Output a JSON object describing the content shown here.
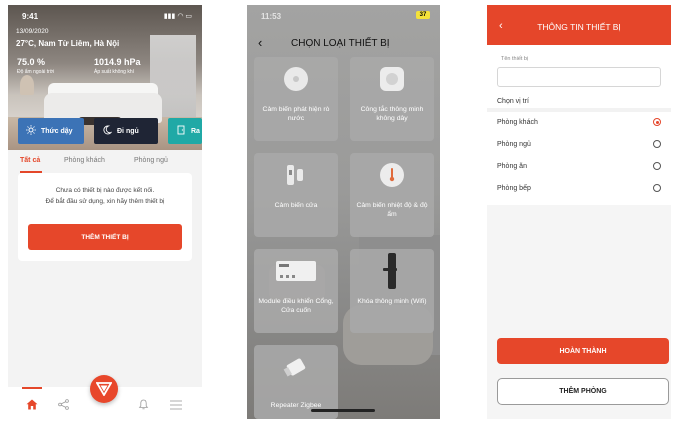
{
  "screen1": {
    "status_time": "9:41",
    "status_icons": "▮▮▮ ◠ ▭",
    "date": "13/09/2020",
    "weather": "27°C, Nam Từ Liêm, Hà Nội",
    "humidity_value": "75.0 %",
    "humidity_label": "Độ ẩm ngoài trời",
    "pressure_value": "1014.9 hPa",
    "pressure_label": "Áp suất không khí",
    "scenes": [
      {
        "label": "Thức dậy",
        "icon": "sun-icon"
      },
      {
        "label": "Đi ngủ",
        "icon": "moon-icon"
      },
      {
        "label": "Ra",
        "icon": "door-icon"
      }
    ],
    "tabs": [
      "Tất cả",
      "Phòng khách",
      "Phòng ngủ"
    ],
    "empty_message_line1": "Chưa có thiết bị nào được kết nối.",
    "empty_message_line2": "Để bắt đầu sử dụng, xin hãy thêm thiết bị",
    "add_device_button": "THÊM THIẾT BỊ",
    "nav_icons": [
      "home-icon",
      "share-icon",
      "logo-icon",
      "bell-icon",
      "menu-icon"
    ],
    "accent_color": "#e6472a"
  },
  "screen2": {
    "status_time": "11:53",
    "battery": "37",
    "title": "CHỌN LOẠI THIẾT BỊ",
    "device_types": [
      {
        "label": "Cảm biến phát hiện rò nước",
        "icon": "water-sensor-icon"
      },
      {
        "label": "Công tắc thông minh không dây",
        "icon": "wireless-switch-icon"
      },
      {
        "label": "Cảm biến cửa",
        "icon": "door-sensor-icon"
      },
      {
        "label": "Cảm biến nhiệt độ & độ ẩm",
        "icon": "thermometer-icon"
      },
      {
        "label": "Module điều khiển Cổng, Cửa cuốn",
        "icon": "gate-module-icon"
      },
      {
        "label": "Khóa thông minh (Wifi)",
        "icon": "smart-lock-icon"
      },
      {
        "label": "Repeater Zigbee",
        "icon": "usb-repeater-icon"
      }
    ]
  },
  "screen3": {
    "title": "THÔNG TIN THIẾT BỊ",
    "name_field_label": "Tên thiết bị",
    "name_field_value": "",
    "section_label": "Chọn vị trí",
    "rooms": [
      {
        "label": "Phòng khách",
        "selected": true
      },
      {
        "label": "Phòng ngủ",
        "selected": false
      },
      {
        "label": "Phòng ăn",
        "selected": false
      },
      {
        "label": "Phòng bếp",
        "selected": false
      }
    ],
    "done_button": "HOÀN THÀNH",
    "add_room_button": "THÊM PHÒNG",
    "accent_color": "#e5462a"
  }
}
